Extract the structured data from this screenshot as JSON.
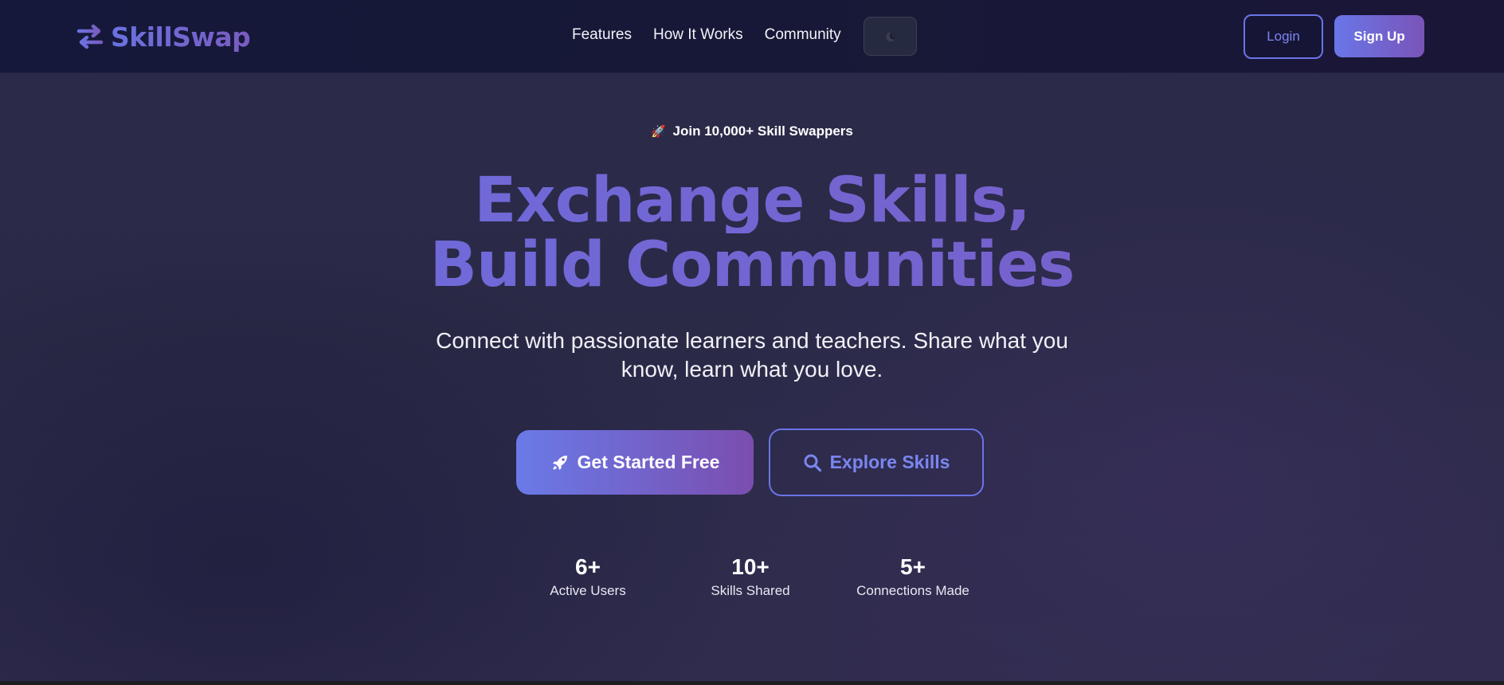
{
  "brand": {
    "name": "SkillSwap",
    "icon": "swap-arrows-icon",
    "gradient": [
      "#6a72e0",
      "#7a5cc0"
    ]
  },
  "nav": {
    "links": [
      "Features",
      "How It Works",
      "Community"
    ],
    "theme_icon": "moon-icon",
    "login_label": "Login",
    "signup_label": "Sign Up"
  },
  "hero": {
    "badge_icon": "🚀",
    "badge_text": "Join 10,000+ Skill Swappers",
    "headline_line1": "Exchange Skills,",
    "headline_line2": "Build Communities",
    "subtitle": "Connect with passionate learners and teachers. Share what you know, learn what you love.",
    "primary_cta": "Get Started Free",
    "primary_cta_icon": "rocket-icon",
    "secondary_cta": "Explore Skills",
    "secondary_cta_icon": "search-icon"
  },
  "stats": [
    {
      "value": "6+",
      "label": "Active Users"
    },
    {
      "value": "10+",
      "label": "Skills Shared"
    },
    {
      "value": "5+",
      "label": "Connections Made"
    }
  ],
  "colors": {
    "accent": "#6a74e6",
    "accent_purple": "#7a54b8",
    "background": "#2a2a48",
    "navbar": "#15183a"
  }
}
